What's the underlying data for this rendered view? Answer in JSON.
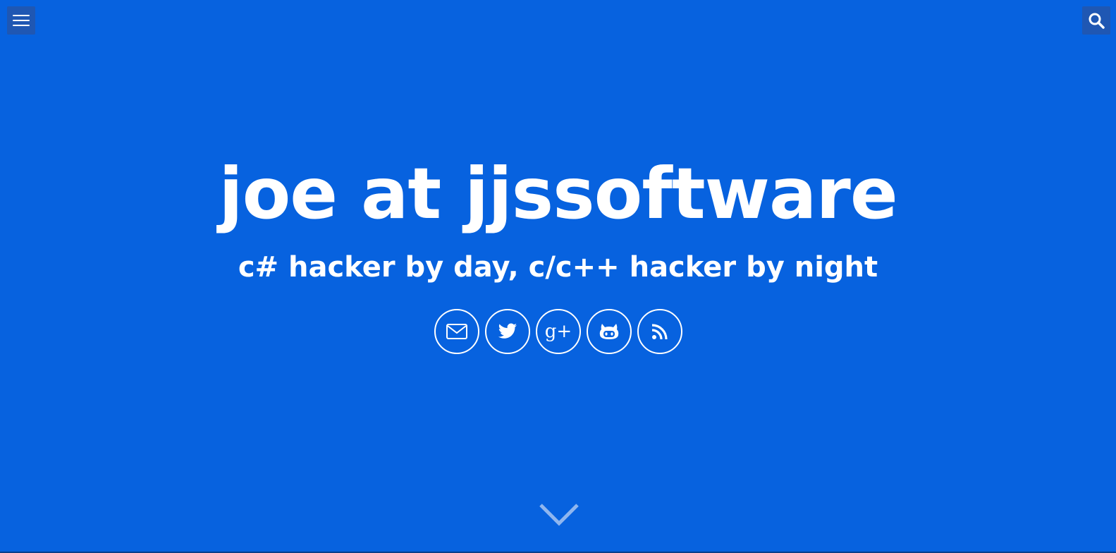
{
  "header": {
    "menu_icon": "hamburger-menu-icon",
    "search_icon": "search-icon"
  },
  "hero": {
    "title": "joe at jjssoftware",
    "subtitle": "c# hacker by day, c/c++ hacker by night"
  },
  "social": [
    {
      "icon": "email-icon",
      "name": "email"
    },
    {
      "icon": "twitter-icon",
      "name": "twitter"
    },
    {
      "icon": "google-plus-icon",
      "name": "google-plus",
      "glyph": "g+"
    },
    {
      "icon": "github-icon",
      "name": "github"
    },
    {
      "icon": "rss-icon",
      "name": "rss"
    }
  ],
  "scroll": {
    "icon": "chevron-down-icon"
  },
  "colors": {
    "background": "#0762df",
    "button_bg": "#1f57b3",
    "text": "#ffffff",
    "chevron": "#8fb6ef"
  }
}
